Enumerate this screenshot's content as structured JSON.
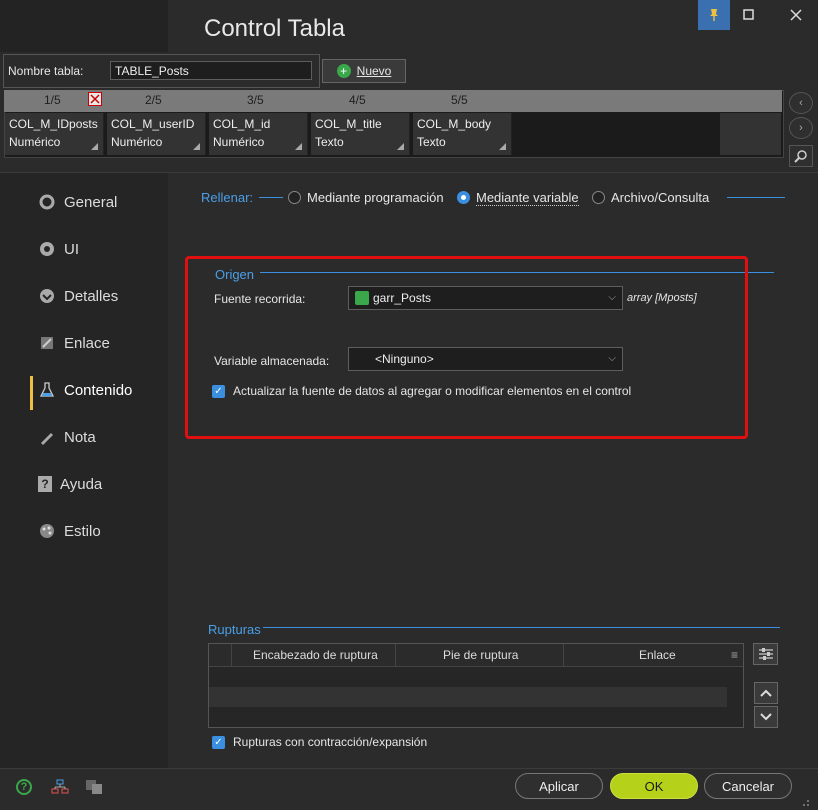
{
  "window": {
    "title": "Control Tabla",
    "pin_icon": "pin-icon",
    "maximize_icon": "maximize-icon",
    "close_icon": "close-icon"
  },
  "table": {
    "name_label": "Nombre tabla:",
    "name_value": "TABLE_Posts",
    "new_button": "Nuevo"
  },
  "columns": [
    {
      "number": "1/5",
      "name": "COL_M_IDposts",
      "type": "Numérico"
    },
    {
      "number": "2/5",
      "name": "COL_M_userID",
      "type": "Numérico"
    },
    {
      "number": "3/5",
      "name": "COL_M_id",
      "type": "Numérico"
    },
    {
      "number": "4/5",
      "name": "COL_M_title",
      "type": "Texto"
    },
    {
      "number": "5/5",
      "name": "COL_M_body",
      "type": "Texto"
    }
  ],
  "nav": {
    "items": [
      {
        "label": "General",
        "icon": "circle-icon"
      },
      {
        "label": "UI",
        "icon": "eye-icon"
      },
      {
        "label": "Detalles",
        "icon": "details-icon"
      },
      {
        "label": "Enlace",
        "icon": "link-icon"
      },
      {
        "label": "Contenido",
        "icon": "flask-icon"
      },
      {
        "label": "Nota",
        "icon": "pen-icon"
      },
      {
        "label": "Ayuda",
        "icon": "help-icon"
      },
      {
        "label": "Estilo",
        "icon": "palette-icon"
      }
    ],
    "active": "Contenido"
  },
  "fill": {
    "label": "Rellenar:",
    "options": [
      "Mediante programación",
      "Mediante variable",
      "Archivo/Consulta"
    ],
    "selected": "Mediante variable"
  },
  "origin": {
    "title": "Origen",
    "source_label": "Fuente recorrida:",
    "source_value": "garr_Posts",
    "source_type": "array [Mposts]",
    "variable_label": "Variable almacenada:",
    "variable_value": "<Ninguno>",
    "update_checkbox": "Actualizar la fuente de datos al agregar o modificar elementos en el control",
    "update_checked": true
  },
  "breaks": {
    "title": "Rupturas",
    "headers": [
      "Encabezado de ruptura",
      "Pie de ruptura",
      "Enlace"
    ],
    "collapse_checkbox": "Rupturas con contracción/expansión",
    "collapse_checked": true
  },
  "footer": {
    "apply": "Aplicar",
    "ok": "OK",
    "cancel": "Cancelar"
  },
  "colors": {
    "accent": "#3a8fe0",
    "ok": "#b5d11a",
    "highlight": "#e01010"
  }
}
